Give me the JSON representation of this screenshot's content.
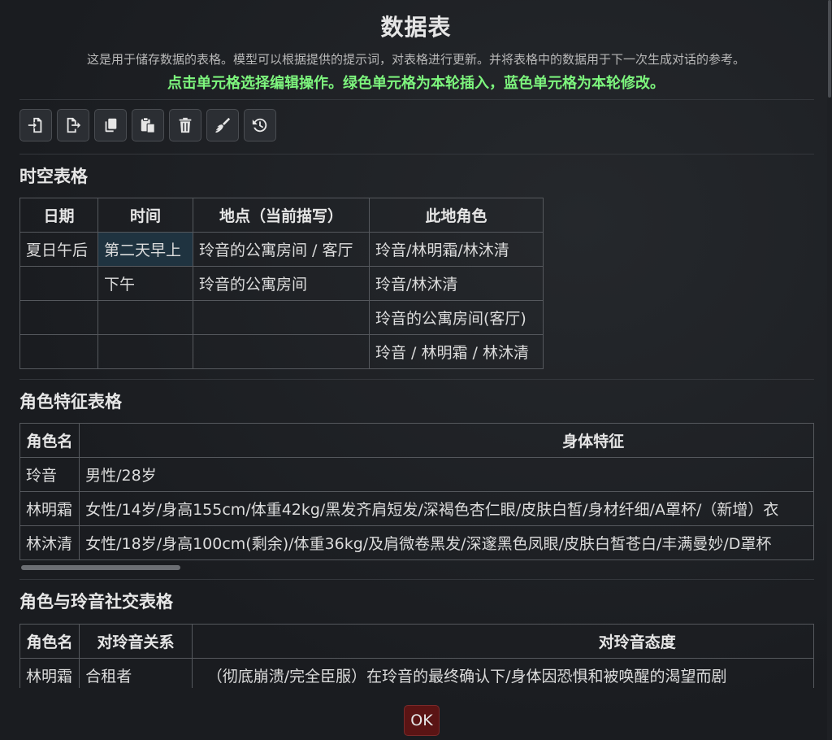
{
  "header": {
    "title": "数据表",
    "description": "这是用于储存数据的表格。模型可以根据提供的提示词，对表格进行更新。并将表格中的数据用于下一次生成对话的参考。",
    "hint": "点击单元格选择编辑操作。绿色单元格为本轮插入，蓝色单元格为本轮修改。"
  },
  "toolbar": {
    "buttons": [
      {
        "icon": "import-icon"
      },
      {
        "icon": "export-icon"
      },
      {
        "icon": "copy-icon"
      },
      {
        "icon": "paste-icon"
      },
      {
        "icon": "trash-icon"
      },
      {
        "icon": "broom-icon"
      },
      {
        "icon": "history-icon"
      }
    ]
  },
  "colors": {
    "hint": "#7df57d",
    "selected_cell": "#1f3340",
    "ok_button": "#5a1414"
  },
  "tables": {
    "spacetime": {
      "title": "时空表格",
      "headers": [
        "日期",
        "时间",
        "地点（当前描写）",
        "此地角色"
      ],
      "rows": [
        [
          "夏日午后",
          "第二天早上",
          "玲音的公寓房间 / 客厅",
          "玲音/林明霜/林沐清"
        ],
        [
          "",
          "下午",
          "玲音的公寓房间",
          "玲音/林沐清"
        ],
        [
          "",
          "",
          "",
          "玲音的公寓房间(客厅)"
        ],
        [
          "",
          "",
          "",
          "玲音 / 林明霜 / 林沐清"
        ]
      ]
    },
    "traits": {
      "title": "角色特征表格",
      "headers": [
        "角色名",
        "身体特征"
      ],
      "rows": [
        [
          "玲音",
          "男性/28岁"
        ],
        [
          "林明霜",
          "女性/14岁/身高155cm/体重42kg/黑发齐肩短发/深褐色杏仁眼/皮肤白皙/身材纤细/A罩杯/（新增）衣"
        ],
        [
          "林沐清",
          "女性/18岁/身高100cm(剩余)/体重36kg/及肩微卷黑发/深邃黑色凤眼/皮肤白皙苍白/丰满曼妙/D罩杯"
        ]
      ]
    },
    "social": {
      "title": "角色与玲音社交表格",
      "headers": [
        "角色名",
        "对玲音关系",
        "对玲音态度"
      ],
      "rows": [
        [
          "林明霜",
          "合租者",
          "（彻底崩溃/完全臣服）在玲音的最终确认下/身体因恐惧和被唤醒的渴望而剧"
        ]
      ]
    }
  },
  "footer": {
    "ok_label": "OK"
  }
}
